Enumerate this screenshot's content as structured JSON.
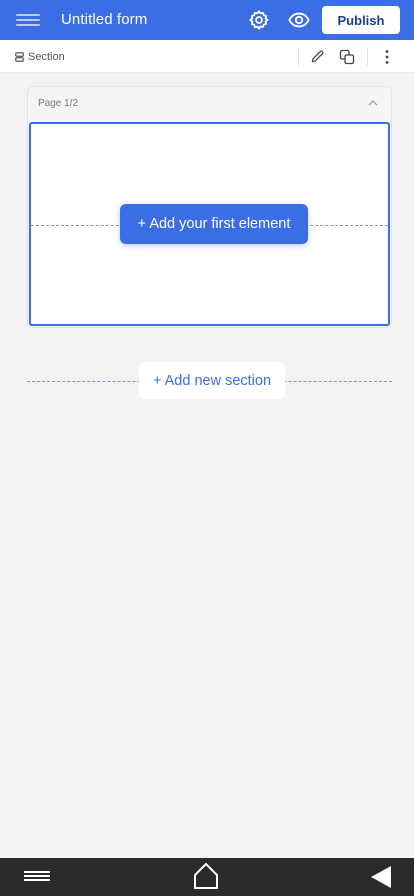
{
  "header": {
    "title": "Untitled form",
    "publish_label": "Publish",
    "icons": [
      "menu-icon",
      "gear-icon",
      "eye-icon"
    ]
  },
  "section_bar": {
    "label": "Section",
    "icons": [
      "section-icon",
      "pencil-icon",
      "copy-icon",
      "more-vertical-icon"
    ]
  },
  "page": {
    "label": "Page 1/2",
    "add_element_label": "+ Add your first element"
  },
  "add_section_label": "+ Add new section",
  "colors": {
    "accent": "#3b6ee4",
    "background": "#f3f3f3",
    "nav_bar": "#2b2b2b",
    "dashed_line": "#8b8fd8"
  },
  "bottom_nav": {
    "icons": [
      "nav-menu-icon",
      "home-icon",
      "back-icon"
    ]
  }
}
